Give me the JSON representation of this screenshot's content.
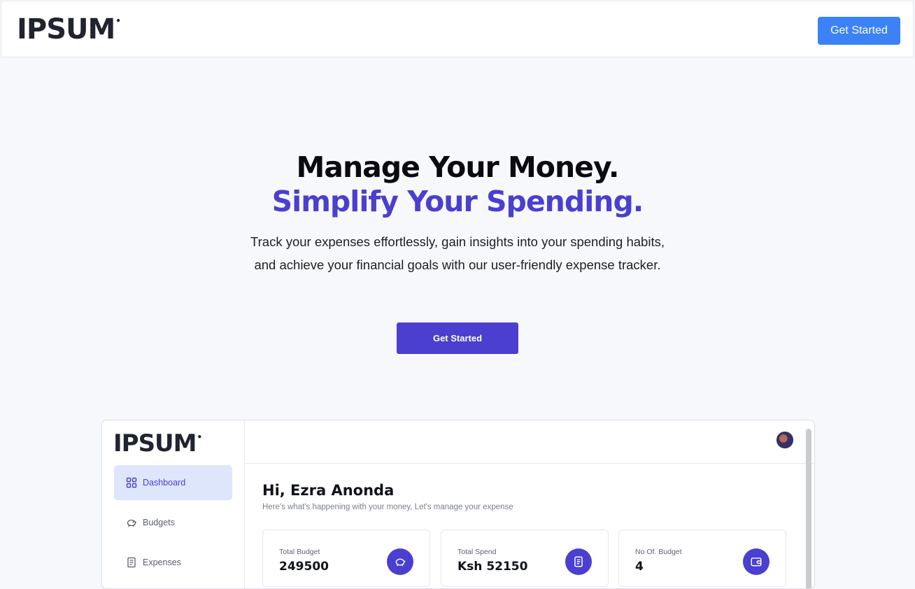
{
  "header": {
    "logo": "IPSUM",
    "logo_mark": "•",
    "cta_label": "Get Started",
    "cta_color": "#3b82f6"
  },
  "hero": {
    "title_line1": "Manage Your Money.",
    "title_line2": "Simplify Your Spending.",
    "description": "Track your expenses effortlessly, gain insights into your spending habits, and achieve your financial goals with our user-friendly expense tracker.",
    "cta_label": "Get Started",
    "accent_color": "#4a3fcf"
  },
  "preview": {
    "logo": "IPSUM",
    "sidebar": {
      "items": [
        {
          "label": "Dashboard",
          "icon": "grid-icon",
          "active": true
        },
        {
          "label": "Budgets",
          "icon": "piggy-bank-icon",
          "active": false
        },
        {
          "label": "Expenses",
          "icon": "receipt-icon",
          "active": false
        }
      ]
    },
    "greeting": "Hi, Ezra Anonda",
    "subtitle": "Here's what's happening with your money, Let's manage your expense",
    "stats": [
      {
        "label": "Total Budget",
        "value": "249500",
        "icon": "piggy-bank-icon"
      },
      {
        "label": "Total Spend",
        "value": "Ksh 52150",
        "icon": "receipt-icon"
      },
      {
        "label": "No Of. Budget",
        "value": "4",
        "icon": "wallet-icon"
      }
    ]
  }
}
